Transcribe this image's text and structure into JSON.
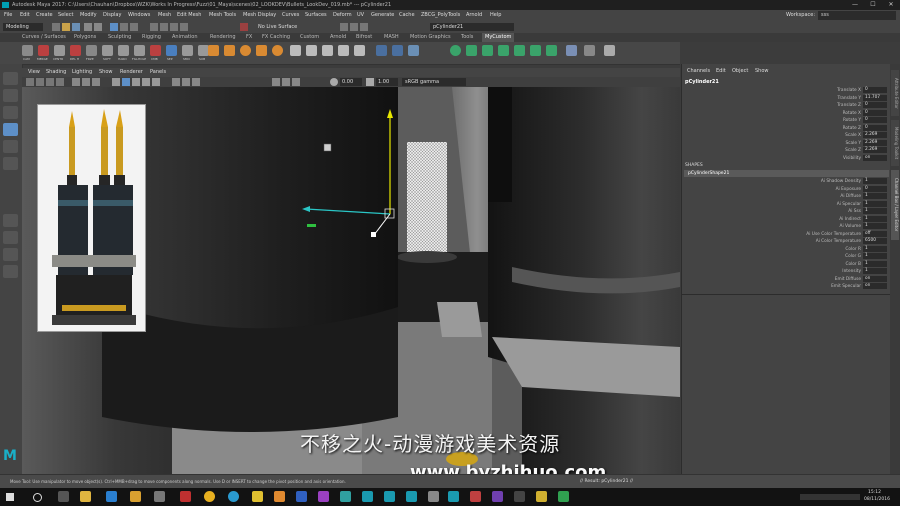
{
  "titlebar": {
    "title": "Autodesk Maya 2017: C:\\Users\\Chauhan\\Dropbox\\WZK\\Works In Progress\\Fuzz\\01_Maya\\scenes\\02_LOOKDEV\\Bullets_LookDev_019.mb*  ---  pCylinder21",
    "minimize": "—",
    "maximize": "☐",
    "close": "✕"
  },
  "menubar": {
    "items": [
      "File",
      "Edit",
      "Create",
      "Select",
      "Modify",
      "Display",
      "Windows",
      "Mesh",
      "Edit Mesh",
      "Mesh Tools",
      "Mesh Display",
      "Curves",
      "Surfaces",
      "Deform",
      "UV",
      "Generate",
      "Cache",
      "ZBCG_PolyTools",
      "Arnold",
      "Help"
    ],
    "workspace_label": "Workspace:",
    "workspace_value": "sss"
  },
  "statusline": {
    "mode": "Modeling",
    "live_surface": "No Live Surface",
    "object_field": "pCylinder21"
  },
  "shelf_tabs": {
    "items": [
      "Curves / Surfaces",
      "Polygons",
      "Sculpting",
      "Rigging",
      "Animation",
      "Rendering",
      "FX",
      "FX Caching",
      "Custom",
      "Arnold",
      "Bifrost",
      "MASH",
      "Motion Graphics",
      "Tools",
      "MyCustom"
    ],
    "active": "MyCustom"
  },
  "shelf": {
    "labels": [
      "CAM",
      "MERGE",
      "CENTR",
      "DEL H",
      "FRZE",
      "SOFT",
      "HARD",
      "FILLHOLE",
      "CMB",
      "SEP",
      "SMO",
      "SUB"
    ]
  },
  "viewport_menu": {
    "items": [
      "View",
      "Shading",
      "Lighting",
      "Show",
      "Renderer",
      "Panels"
    ]
  },
  "viewport_toolbar": {
    "val1": "0.00",
    "val2": "1.00",
    "colorspace": "sRGB gamma"
  },
  "watermark": {
    "cn": "不移之火-动漫游戏美术资源",
    "url": "www.byzhihuo.com"
  },
  "channelbox": {
    "menu": [
      "Channels",
      "Edit",
      "Object",
      "Show"
    ],
    "object_name": "pCylinder21",
    "transform": [
      {
        "name": "Translate X",
        "value": "0"
      },
      {
        "name": "Translate Y",
        "value": "11.707"
      },
      {
        "name": "Translate Z",
        "value": "0"
      },
      {
        "name": "Rotate X",
        "value": "0"
      },
      {
        "name": "Rotate Y",
        "value": "0"
      },
      {
        "name": "Rotate Z",
        "value": "0"
      },
      {
        "name": "Scale X",
        "value": "2.269"
      },
      {
        "name": "Scale Y",
        "value": "2.269"
      },
      {
        "name": "Scale Z",
        "value": "2.269"
      },
      {
        "name": "Visibility",
        "value": "on"
      }
    ],
    "shapes_header": "SHAPES",
    "shape_name": "pCylinderShape21",
    "shape_attrs": [
      {
        "name": "Ai Shadow Density",
        "value": "1"
      },
      {
        "name": "Ai Exposure",
        "value": "0"
      },
      {
        "name": "Ai Diffuse",
        "value": "1"
      },
      {
        "name": "Ai Specular",
        "value": "1"
      },
      {
        "name": "Ai Sss",
        "value": "1"
      },
      {
        "name": "Ai Indirect",
        "value": "1"
      },
      {
        "name": "Ai Volume",
        "value": "1"
      },
      {
        "name": "Ai Use Color Temperature",
        "value": "off"
      },
      {
        "name": "Ai Color Temperature",
        "value": "6500"
      },
      {
        "name": "Color R",
        "value": "1"
      },
      {
        "name": "Color G",
        "value": "1"
      },
      {
        "name": "Color B",
        "value": "1"
      },
      {
        "name": "Intensity",
        "value": "1"
      },
      {
        "name": "Emit Diffuse",
        "value": "on"
      },
      {
        "name": "Emit Specular",
        "value": "on"
      }
    ]
  },
  "side_tabs": [
    "Attribute Editor",
    "Modeling Toolkit",
    "Channel Box / Layer Editor"
  ],
  "helpline": {
    "text": "Move Tool: Use manipulator to move object(s). Ctrl+MMB+drag to move components along normals. Use D or INSERT to change the pivot position and axis orientation.",
    "result": "// Result: pCylinder21 //"
  },
  "taskbar": {
    "time": "15:12",
    "date": "08/11/2016"
  },
  "colors": {
    "maya_accent": "#00a0b4",
    "selected_tool": "#5d8fc7",
    "manip_y": "#e8e800",
    "manip_x": "#2ac6c6",
    "manip_z": "#2fc040"
  }
}
